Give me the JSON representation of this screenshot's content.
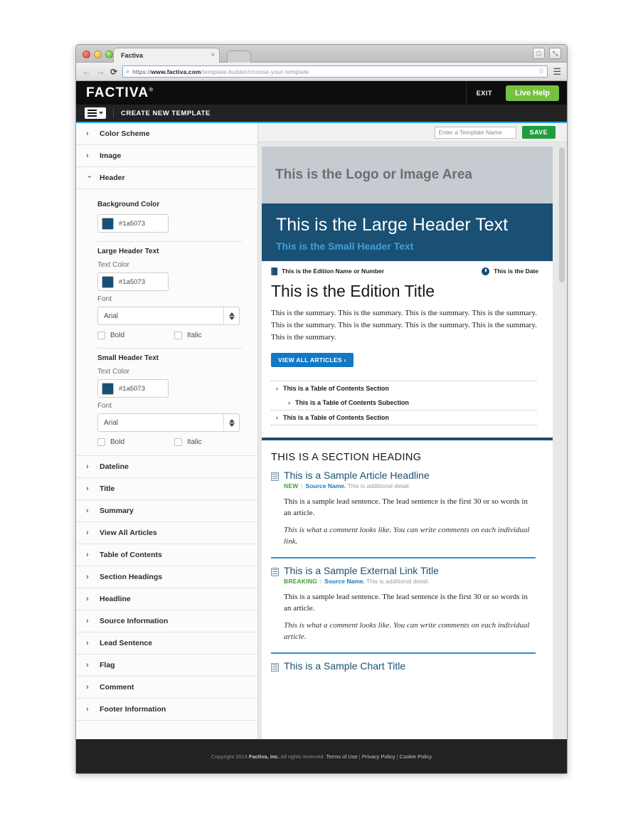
{
  "browser": {
    "tab_title": "Factiva",
    "tab_close": "×",
    "back": "←",
    "forward": "→",
    "reload": "⟳",
    "search_icon": "⌕",
    "url_protocol": "https://",
    "url_domain": "www.factiva.com",
    "url_path": "/template-builder/choose-your-template",
    "star_icon": "☆",
    "menu_icon": "☰",
    "profile_icon": "□",
    "fullscreen_icon": "⤡"
  },
  "brandbar": {
    "logo": "FACTIVA",
    "logo_mark": "®",
    "exit_label": "EXIT",
    "live_help_label": "Live Help"
  },
  "subbar": {
    "title": "CREATE NEW TEMPLATE"
  },
  "sidebar": {
    "sections_before": [
      {
        "label": "Color Scheme",
        "expanded": false
      },
      {
        "label": "Image",
        "expanded": false
      }
    ],
    "header_section": {
      "label": "Header",
      "background_color_label": "Background Color",
      "background_color_value": "#1a5073",
      "large_header_group": "Large Header Text",
      "large_text_color_label": "Text Color",
      "large_text_color_value": "#1a5073",
      "large_font_label": "Font",
      "large_font_value": "Arial",
      "large_bold_label": "Bold",
      "large_italic_label": "Italic",
      "small_header_group": "Small Header Text",
      "small_text_color_label": "Text Color",
      "small_text_color_value": "#1a5073",
      "small_font_label": "Font",
      "small_font_value": "Arial",
      "small_bold_label": "Bold",
      "small_italic_label": "Italic"
    },
    "sections_after": [
      {
        "label": "Dateline"
      },
      {
        "label": "Title"
      },
      {
        "label": "Summary"
      },
      {
        "label": "View All Articles"
      },
      {
        "label": "Table of Contents"
      },
      {
        "label": "Section Headings"
      },
      {
        "label": "Headline"
      },
      {
        "label": "Source Information"
      },
      {
        "label": "Lead Sentence"
      },
      {
        "label": "Flag"
      },
      {
        "label": "Comment"
      },
      {
        "label": "Footer Information"
      }
    ],
    "chevron_collapsed": "›",
    "chevron_expanded": "›"
  },
  "preview_toolbar": {
    "template_name_placeholder": "Enter a Template Name",
    "template_name_value": "",
    "save_label": "SAVE"
  },
  "preview": {
    "logo_area_text": "This is the Logo or Image Area",
    "large_header_text": "This is the Large Header Text",
    "small_header_text": "This is the Small Header Text",
    "edition_name": "This is the Edition Name or Number",
    "edition_date": "This is the Date",
    "edition_title": "This is the Edition Title",
    "summary": "This is the summary. This is the summary. This is the summary. This is the summary. This is the summary. This is the summary. This is the summary. This is the summary. This is the summary.",
    "view_all_label": "VIEW ALL ARTICLES ›",
    "toc": [
      {
        "text": "This is a Table of Contents Section",
        "level": 1
      },
      {
        "text": "This is a Table of Contents Subection",
        "level": 2
      },
      {
        "text": "This is a Table of Contents Section",
        "level": 1
      }
    ],
    "section_heading": "THIS IS A SECTION HEADING",
    "articles": [
      {
        "title": "This is a Sample Article Headline",
        "flag": "NEW",
        "source": "Source Name.",
        "detail": "This is additional detail.",
        "lead": "This is a sample lead sentence. The lead sentence is the first 30 or so words in an article.",
        "comment": "This is what a comment looks like. You can write comments on each individual link."
      },
      {
        "title": "This is a Sample External Link Title",
        "flag": "BREAKING",
        "source": "Source Name.",
        "detail": "This is additional detail.",
        "lead": "This is a sample lead sentence. The lead sentence is the first 30 or so words in an article.",
        "comment": "This is what a comment looks like. You can write comments on each individual article."
      }
    ],
    "chart_title": "This is a Sample Chart Title"
  },
  "footer": {
    "copyright_prefix": "Copyright 2014 ",
    "company": "Factiva, Inc.",
    "rights": " All rights reserved. ",
    "terms": "Terms of Use",
    "sep1": " | ",
    "privacy": "Privacy Policy",
    "sep2": " | ",
    "cookie": "Cookie Policy"
  },
  "colors": {
    "brand_dark": "#0d0d0d",
    "accent_blue": "#2da3e0",
    "header_navy": "#1a5073",
    "green_help": "#76c043",
    "save_green": "#1e9e3e",
    "link_blue": "#1479c4"
  }
}
